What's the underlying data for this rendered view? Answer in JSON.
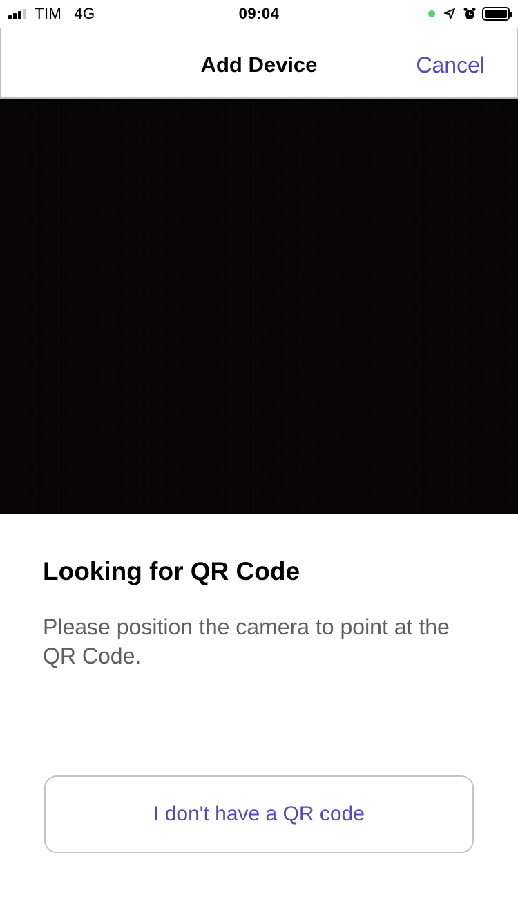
{
  "status_bar": {
    "carrier": "TIM",
    "network": "4G",
    "time": "09:04",
    "signal_icon": "signal-bars-icon",
    "camera_indicator_color": "#4cd964",
    "location_icon": "location-arrow-icon",
    "alarm_icon": "alarm-clock-icon",
    "battery_icon": "battery-full-icon"
  },
  "nav": {
    "title": "Add Device",
    "cancel_label": "Cancel"
  },
  "content": {
    "heading": "Looking for QR Code",
    "message": "Please position the camera to point at the QR Code.",
    "no_qr_button_label": "I don't have a QR code"
  },
  "colors": {
    "accent": "#5c46c0",
    "camera_background": "#050404"
  }
}
